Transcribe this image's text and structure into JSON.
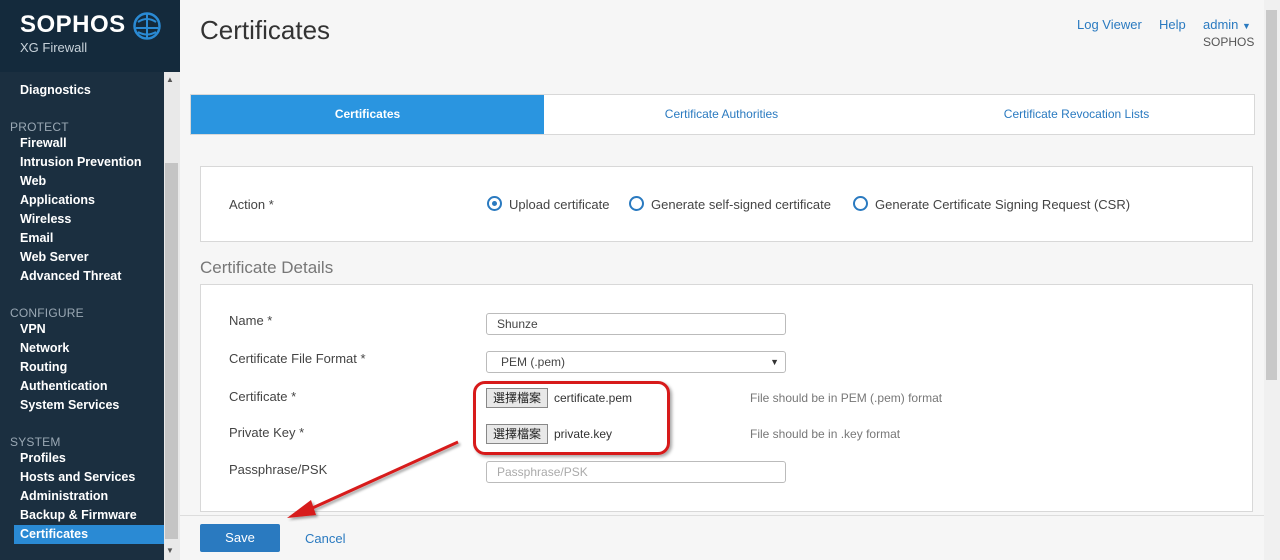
{
  "sidebar": {
    "logo": "SOPHOS",
    "product": "XG Firewall",
    "items_top": [
      "Diagnostics"
    ],
    "protect": {
      "title": "PROTECT",
      "items": [
        "Firewall",
        "Intrusion Prevention",
        "Web",
        "Applications",
        "Wireless",
        "Email",
        "Web Server",
        "Advanced Threat"
      ]
    },
    "configure": {
      "title": "CONFIGURE",
      "items": [
        "VPN",
        "Network",
        "Routing",
        "Authentication",
        "System Services"
      ]
    },
    "system": {
      "title": "SYSTEM",
      "items": [
        "Profiles",
        "Hosts and Services",
        "Administration",
        "Backup & Firmware",
        "Certificates"
      ]
    },
    "accent": "#2a8ad4"
  },
  "header": {
    "title": "Certificates",
    "log_viewer": "Log Viewer",
    "help": "Help",
    "user": "admin",
    "org": "SOPHOS"
  },
  "tabs": [
    "Certificates",
    "Certificate Authorities",
    "Certificate Revocation Lists"
  ],
  "action": {
    "label": "Action *",
    "options": [
      "Upload certificate",
      "Generate self-signed certificate",
      "Generate Certificate Signing Request (CSR)"
    ],
    "selected": 0
  },
  "details": {
    "title": "Certificate Details",
    "name_label": "Name *",
    "name_value": "Shunze",
    "format_label": "Certificate File Format *",
    "format_value": "PEM (.pem)",
    "cert_label": "Certificate *",
    "choose_file": "選擇檔案",
    "cert_file": "certificate.pem",
    "cert_hint": "File should be in PEM (.pem) format",
    "key_label": "Private Key *",
    "key_file": "private.key",
    "key_hint": "File should be in .key format",
    "pass_label": "Passphrase/PSK",
    "pass_placeholder": "Passphrase/PSK"
  },
  "footer": {
    "save": "Save",
    "cancel": "Cancel"
  },
  "colors": {
    "primary": "#2a7ac0",
    "sidebar_bg": "#142a3c",
    "annotation": "#d71a1a"
  }
}
